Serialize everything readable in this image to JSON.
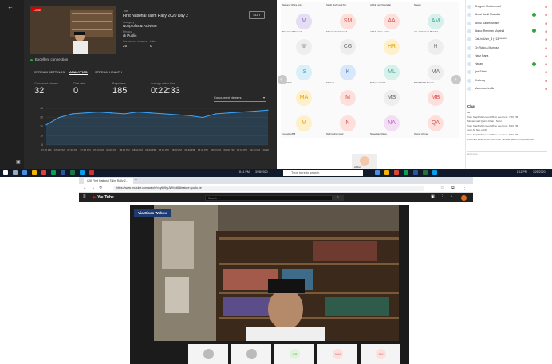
{
  "yt_studio": {
    "live_badge": "LIVE",
    "title_label": "Title",
    "title": "First National Talim Rally 2020 Day 2",
    "category_label": "Category",
    "category": "Nonprofits & Activism",
    "privacy_label": "Privacy",
    "privacy": "Public",
    "concurrent_label": "Concurrent viewers",
    "concurrent_value": "25",
    "likes_label": "Likes",
    "likes_value": "0",
    "end_button": "EDIT",
    "connection": "Excellent connection",
    "tabs": [
      "STREAM SETTINGS",
      "ANALYTICS",
      "STREAM HEALTH"
    ],
    "stats": [
      {
        "label": "Concurrent viewers",
        "value": "32"
      },
      {
        "label": "Chat rate",
        "value": "0"
      },
      {
        "label": "Pageviews",
        "value": "185"
      },
      {
        "label": "Average watch time",
        "value": "0:22:33"
      }
    ],
    "dropdown": "Concurrent viewers"
  },
  "chart_data": {
    "type": "area",
    "x": [
      "07:26 PM",
      "07:33 PM",
      "07:40 PM",
      "07:46 PM",
      "07:53 PM",
      "08:00 PM",
      "08:06 PM",
      "08:13 PM",
      "08:20 PM",
      "08:26 PM",
      "08:33 PM",
      "08:40 PM",
      "08:46 PM",
      "08:53 PM",
      "09:00 PM",
      "09:06 PM",
      "09:13 PM",
      "09:20 PM"
    ],
    "values": [
      22,
      30,
      34,
      35,
      36,
      35,
      34,
      36,
      35,
      34,
      33,
      32,
      30,
      34,
      35,
      36,
      37,
      38
    ],
    "yticks": [
      0,
      10,
      20,
      30,
      40
    ],
    "ylim": [
      0,
      40
    ],
    "color": "#3ea6ff"
  },
  "webex": {
    "tiles": [
      {
        "name": "National Office M.k...",
        "initials": "",
        "color": "#e8e8e8",
        "text": "#888"
      },
      {
        "name": "Saqib Mahmood MF",
        "initials": "",
        "color": "#e8e8e8",
        "text": "#888"
      },
      {
        "name": "Abdul Jamil Muzaffar",
        "initials": "",
        "color": "#e8e8e8",
        "text": "#888"
      },
      {
        "name": "Naeem",
        "initials": "",
        "color": "#e8e8e8",
        "text": "#888"
      },
      {
        "name": "Mubarak Mahmood",
        "initials": "M",
        "color": "#e4def5",
        "text": "#8a70c8"
      },
      {
        "name": "Shagoor Muhammad",
        "initials": "SM",
        "color": "#fde0dc",
        "text": "#d9534f"
      },
      {
        "name": "Abdul Salam Aslam",
        "initials": "AA",
        "color": "#fde0dc",
        "text": "#d9534f"
      },
      {
        "name": "Ata-ur-Rehman Mujahid",
        "initials": "AM",
        "color": "#d8f0ec",
        "text": "#3aa68f"
      },
      {
        "name": "Call-in User_3 (+13...)",
        "initials": "☏",
        "color": "#eeeeee",
        "text": "#666"
      },
      {
        "name": "Ch Rafiq A Mumtaz",
        "initials": "CG",
        "color": "#eeeeee",
        "text": "#666"
      },
      {
        "name": "Hafiz Rana",
        "initials": "HR",
        "color": "#fff0cc",
        "text": "#e0a000"
      },
      {
        "name": "Hasan",
        "initials": "H",
        "color": "#eeeeee",
        "text": "#888"
      },
      {
        "name": "Ijaz Shah",
        "initials": "IS",
        "color": "#d8f0f8",
        "text": "#3a9cc8"
      },
      {
        "name": "Khaleeq",
        "initials": "K",
        "color": "#d8e7fa",
        "text": "#4a80c8"
      },
      {
        "name": "Mahmood trafik",
        "initials": "ML",
        "color": "#d8f0ec",
        "text": "#3aa68f"
      },
      {
        "name": "MAHMOOD Ahmad",
        "initials": "MA",
        "color": "#eeeeee",
        "text": "#666"
      },
      {
        "name": "Mansoor Ahmed",
        "initials": "MA",
        "color": "#fff0cc",
        "text": "#e0a000"
      },
      {
        "name": "Maqsood",
        "initials": "M",
        "color": "#fde0dc",
        "text": "#d9534f"
      },
      {
        "name": "Manan Sharma",
        "initials": "MS",
        "color": "#eeeeee",
        "text": "#666"
      },
      {
        "name": "Mubashar Sheikh Muhammad...",
        "initials": "MB",
        "color": "#fde0dc",
        "text": "#d9534f"
      },
      {
        "name": "mujeeba.888",
        "initials": "M",
        "color": "#fff0cc",
        "text": "#e0a000"
      },
      {
        "name": "Nadi Muhammad",
        "initials": "N",
        "color": "#fde0dc",
        "text": "#d9534f"
      },
      {
        "name": "Naveduan Malay",
        "initials": "NA",
        "color": "#f4def5",
        "text": "#b060b8"
      },
      {
        "name": "Qamar Ahmad",
        "initials": "QA",
        "color": "#fde0dc",
        "text": "#d9534f"
      }
    ],
    "participants": [
      {
        "name": "Shagoor Muhammad",
        "video": false,
        "mute": true
      },
      {
        "name": "Abdul Jamil Muzaffar",
        "video": true,
        "mute": true
      },
      {
        "name": "Abdul Salam Aslam",
        "video": false,
        "mute": true
      },
      {
        "name": "Ata-ur-Rehman Mujahid",
        "video": true,
        "mute": true
      },
      {
        "name": "Call-in User_3 (+13*******)",
        "video": false,
        "mute": true
      },
      {
        "name": "Ch Rafiq A Mumtaz",
        "video": false,
        "mute": true
      },
      {
        "name": "Hafiz Rana",
        "video": false,
        "mute": true
      },
      {
        "name": "Hasan",
        "video": true,
        "mute": true
      },
      {
        "name": "Ijaz Shah",
        "video": false,
        "mute": true
      },
      {
        "name": "Khaleeq",
        "video": false,
        "mute": true
      },
      {
        "name": "Mahmood trafik",
        "video": false,
        "mute": true
      }
    ],
    "chat_title": "Chat",
    "chat_messages": [
      "ok",
      "from Saqib Mahmood MF to everyone: 7:46 PM",
      "Muhammad Qasim Khan - Noori",
      "from Saqib Mahmood MF to everyone: 8:16 PM",
      "noor Ali Neo sahib",
      "from Saqib Mahmood MF to everyone: 8:40 PM",
      "if Ali Neo sahib is not there then Tanveer sahib is not participant"
    ],
    "chat_input": "Everyone",
    "self_name": "Abdul"
  },
  "taskbar": {
    "search": "Type here to search",
    "time_left": "8:11 PM",
    "date_left": "3/28/2020",
    "time_right": "8:11 PM",
    "date_right": "3/28/2020"
  },
  "browser": {
    "tab_title": "(25) First National Talim Rally 2...",
    "url": "https://www.youtube.com/watch?v=ytM9yUWVdd8&feature=youtu.be",
    "youtube_logo": "YouTube",
    "search_placeholder": "Search",
    "webex_badge": "Via Cisco Webex",
    "strip": [
      {
        "initials": "",
        "color": "#bbb",
        "text": "#555"
      },
      {
        "initials": "",
        "color": "#bbb",
        "text": "#555"
      },
      {
        "initials": "NO",
        "color": "#e2f3dd",
        "text": "#4a9a3a"
      },
      {
        "initials": "MM",
        "color": "#fde0dc",
        "text": "#d9534f"
      },
      {
        "initials": "SM",
        "color": "#fde0dc",
        "text": "#d9534f"
      }
    ]
  }
}
